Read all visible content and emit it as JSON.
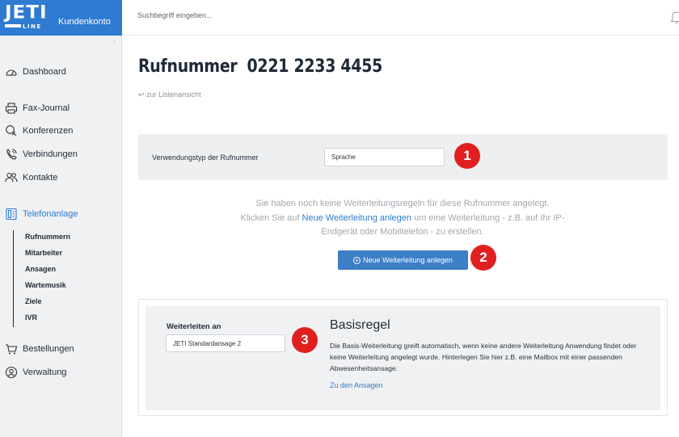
{
  "header": {
    "brand_logo": "JETI",
    "brand_sub": "LINE",
    "brand_title": "Kundenkonto",
    "search_placeholder": "Suchbegriff eingeben..."
  },
  "sidebar": {
    "collapse_glyph": "‹",
    "items": [
      {
        "label": "Dashboard",
        "icon": "gauge-icon"
      },
      {
        "label": "Fax-Journal",
        "icon": "printer-icon"
      },
      {
        "label": "Konferenzen",
        "icon": "chat-icon"
      },
      {
        "label": "Verbindungen",
        "icon": "phone-icon"
      },
      {
        "label": "Kontakte",
        "icon": "contacts-icon"
      },
      {
        "label": "Telefonanlage",
        "icon": "pbx-icon",
        "active": true
      },
      {
        "label": "Bestellungen",
        "icon": "cart-icon"
      },
      {
        "label": "Verwaltung",
        "icon": "user-circle-icon"
      }
    ],
    "subitems": [
      "Rufnummern",
      "Mitarbeiter",
      "Ansagen",
      "Wartemusik",
      "Ziele",
      "IVR"
    ]
  },
  "main": {
    "title_label": "Rufnummer",
    "title_number": "0221 2233 4455",
    "back_link": "zur Listenansicht",
    "type_label": "Verwendungstyp der Rufnummer",
    "type_value": "Sprache",
    "info_line1": "Sie haben noch keine Weiterleitungsregeln für diese Rufnummer angelegt.",
    "info_line2_pre": "Klicken Sie auf ",
    "info_line2_link": "Neue Weiterleitung anlegen",
    "info_line2_post": " um eine Weiterleitung - z.B. auf Ihr IP-",
    "info_line3": "Endgerät oder Mobiltelefon - zu erstellen.",
    "new_button": "Neue Weiterleitung anlegen",
    "forward_label": "Weiterleiten an",
    "forward_value": "JETI Standardansage 2",
    "rule_title": "Basisregel",
    "rule_desc": "Die Basis-Weiterleitung greift automatisch, wenn keine andere Weiterleitung Anwendung findet oder keine Weiterleitung angelegt wurde. Hinterlegen Sie hier z.B. eine Mailbox mit einer passenden Abwesenheitsansage.",
    "rule_link": "Zu den Ansagen"
  },
  "badges": [
    "1",
    "2",
    "3"
  ],
  "colors": {
    "brand": "#2e7bd1",
    "button": "#3d7fc7",
    "badge": "#e02020",
    "sidebar_bg": "#f0f1f2"
  }
}
